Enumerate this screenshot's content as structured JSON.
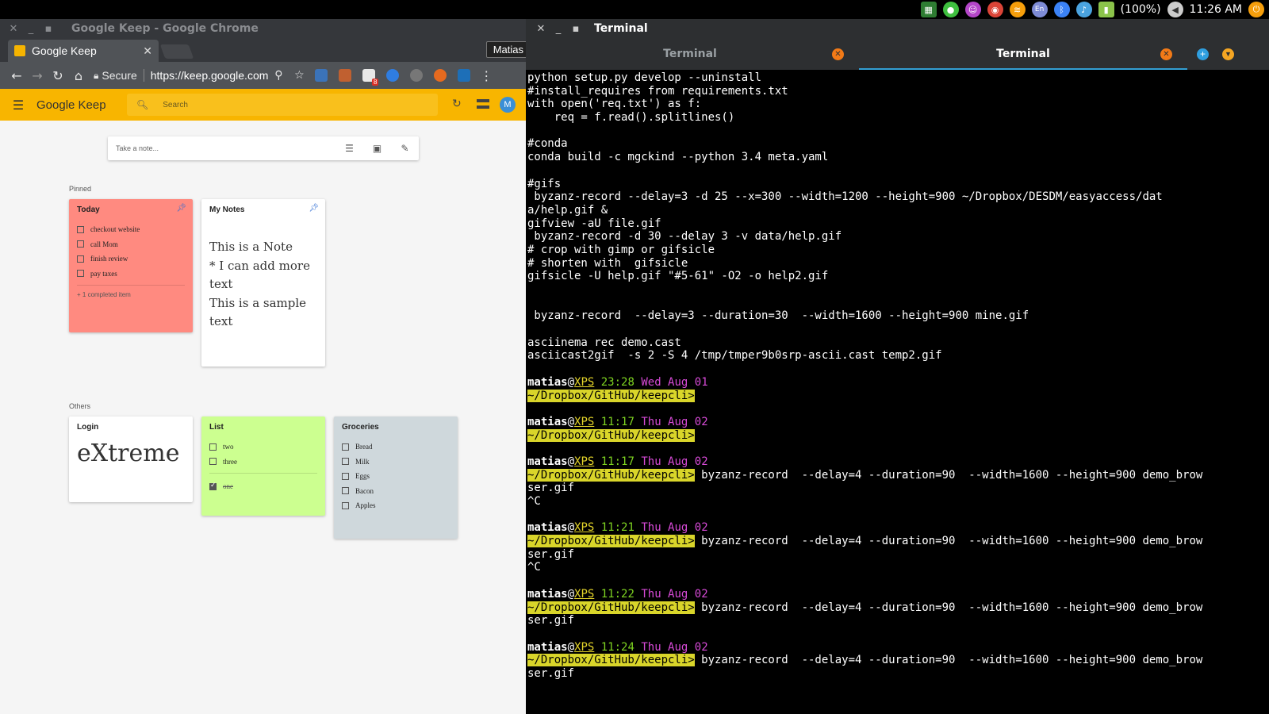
{
  "system": {
    "battery_text": "(100%)",
    "clock": "11:26 AM",
    "tray_colors": [
      "#2e7d32",
      "#3fbf3f",
      "#b446c8",
      "#e0e0e0",
      "#f59e0b",
      "#7e8bd6",
      "#3b82f6",
      "#4aa3df",
      "#8bc34a",
      "#cccccc",
      "#f59e0b"
    ]
  },
  "chrome": {
    "window_title": "Google Keep - Google Chrome",
    "tab_label": "Google Keep",
    "profile": "Matias",
    "secure_label": "Secure",
    "url": "https://keep.google.com",
    "gmail_badge": "8"
  },
  "keep": {
    "logo": "Google Keep",
    "search_placeholder": "Search",
    "avatar_letter": "M",
    "take_note_placeholder": "Take a note...",
    "pinned_label": "Pinned",
    "others_label": "Others",
    "notes": {
      "today": {
        "title": "Today",
        "color": "#ff8a80",
        "items": [
          "checkout website",
          "call Mom",
          "finish review",
          "pay taxes"
        ],
        "completed": "+ 1 completed item"
      },
      "mynotes": {
        "title": "My Notes",
        "lines": [
          "This is a Note",
          "* I can add more",
          "text",
          "This is a sample",
          "text"
        ]
      },
      "login": {
        "title": "Login",
        "text": "eXtreme"
      },
      "list": {
        "title": "List",
        "color": "#ccff90",
        "items": [
          "two",
          "three"
        ],
        "done": [
          "one"
        ]
      },
      "groceries": {
        "title": "Groceries",
        "color": "#cfd8dc",
        "items": [
          "Bread",
          "Milk",
          "Eggs",
          "Bacon",
          "Apples"
        ]
      }
    }
  },
  "terminal": {
    "window_title": "Terminal",
    "tabs": [
      "Terminal",
      "Terminal"
    ],
    "lines": [
      {
        "t": "text",
        "v": "python setup.py develop --uninstall"
      },
      {
        "t": "text",
        "v": "#install_requires from requirements.txt"
      },
      {
        "t": "text",
        "v": "with open('req.txt') as f:"
      },
      {
        "t": "text",
        "v": "    req = f.read().splitlines()"
      },
      {
        "t": "text",
        "v": ""
      },
      {
        "t": "text",
        "v": "#conda"
      },
      {
        "t": "text",
        "v": "conda build -c mgckind --python 3.4 meta.yaml"
      },
      {
        "t": "text",
        "v": ""
      },
      {
        "t": "text",
        "v": "#gifs"
      },
      {
        "t": "text",
        "v": " byzanz-record --delay=3 -d 25 --x=300 --width=1200 --height=900 ~/Dropbox/DESDM/easyaccess/dat"
      },
      {
        "t": "text",
        "v": "a/help.gif &"
      },
      {
        "t": "text",
        "v": "gifview -aU file.gif"
      },
      {
        "t": "text",
        "v": " byzanz-record -d 30 --delay 3 -v data/help.gif"
      },
      {
        "t": "text",
        "v": "# crop with gimp or gifsicle"
      },
      {
        "t": "text",
        "v": "# shorten with  gifsicle"
      },
      {
        "t": "text",
        "v": "gifsicle -U help.gif \"#5-61\" -O2 -o help2.gif"
      },
      {
        "t": "text",
        "v": ""
      },
      {
        "t": "text",
        "v": ""
      },
      {
        "t": "text",
        "v": " byzanz-record  --delay=3 --duration=30  --width=1600 --height=900 mine.gif"
      },
      {
        "t": "text",
        "v": ""
      },
      {
        "t": "text",
        "v": "asciinema rec demo.cast"
      },
      {
        "t": "text",
        "v": "asciicast2gif  -s 2 -S 4 /tmp/tmper9b0srp-ascii.cast temp2.gif"
      },
      {
        "t": "text",
        "v": ""
      },
      {
        "t": "prompt",
        "user": "matias",
        "host": "XPS",
        "time": "23:28",
        "date": "Wed Aug 01"
      },
      {
        "t": "cwd",
        "v": "~/Dropbox/GitHub/keepcli>",
        "cmd": ""
      },
      {
        "t": "text",
        "v": ""
      },
      {
        "t": "prompt",
        "user": "matias",
        "host": "XPS",
        "time": "11:17",
        "date": "Thu Aug 02"
      },
      {
        "t": "cwd",
        "v": "~/Dropbox/GitHub/keepcli>",
        "cmd": ""
      },
      {
        "t": "text",
        "v": ""
      },
      {
        "t": "prompt",
        "user": "matias",
        "host": "XPS",
        "time": "11:17",
        "date": "Thu Aug 02"
      },
      {
        "t": "cwd",
        "v": "~/Dropbox/GitHub/keepcli>",
        "cmd": " byzanz-record  --delay=4 --duration=90  --width=1600 --height=900 demo_brow"
      },
      {
        "t": "text",
        "v": "ser.gif"
      },
      {
        "t": "text",
        "v": "^C"
      },
      {
        "t": "text",
        "v": ""
      },
      {
        "t": "prompt",
        "user": "matias",
        "host": "XPS",
        "time": "11:21",
        "date": "Thu Aug 02"
      },
      {
        "t": "cwd",
        "v": "~/Dropbox/GitHub/keepcli>",
        "cmd": " byzanz-record  --delay=4 --duration=90  --width=1600 --height=900 demo_brow"
      },
      {
        "t": "text",
        "v": "ser.gif"
      },
      {
        "t": "text",
        "v": "^C"
      },
      {
        "t": "text",
        "v": ""
      },
      {
        "t": "prompt",
        "user": "matias",
        "host": "XPS",
        "time": "11:22",
        "date": "Thu Aug 02"
      },
      {
        "t": "cwd",
        "v": "~/Dropbox/GitHub/keepcli>",
        "cmd": " byzanz-record  --delay=4 --duration=90  --width=1600 --height=900 demo_brow"
      },
      {
        "t": "text",
        "v": "ser.gif"
      },
      {
        "t": "text",
        "v": ""
      },
      {
        "t": "prompt",
        "user": "matias",
        "host": "XPS",
        "time": "11:24",
        "date": "Thu Aug 02"
      },
      {
        "t": "cwd",
        "v": "~/Dropbox/GitHub/keepcli>",
        "cmd": " byzanz-record  --delay=4 --duration=90  --width=1600 --height=900 demo_brow"
      },
      {
        "t": "text",
        "v": "ser.gif"
      }
    ]
  }
}
